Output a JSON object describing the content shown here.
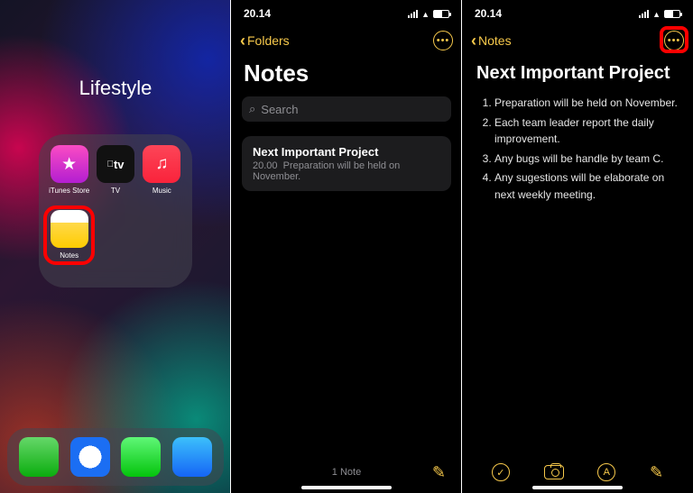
{
  "pane1": {
    "folder_name": "Lifestyle",
    "apps": [
      {
        "label": "iTunes Store",
        "glyph": "★"
      },
      {
        "label": "TV",
        "glyph": "tv"
      },
      {
        "label": "Music",
        "glyph": "♫"
      },
      {
        "label": "Notes",
        "glyph": ""
      }
    ]
  },
  "pane2": {
    "time": "20.14",
    "back_label": "Folders",
    "page_title": "Notes",
    "search_placeholder": "Search",
    "note": {
      "title": "Next Important Project",
      "time": "20.00",
      "preview": "Preparation will be held on November."
    },
    "footer_count": "1 Note"
  },
  "pane3": {
    "time": "20.14",
    "back_label": "Notes",
    "note_title": "Next Important Project",
    "items": [
      "Preparation will be held on November.",
      "Each team leader report the daily improvement.",
      "Any bugs will be handle by team C.",
      "Any sugestions will be elaborate on next weekly meeting."
    ]
  }
}
